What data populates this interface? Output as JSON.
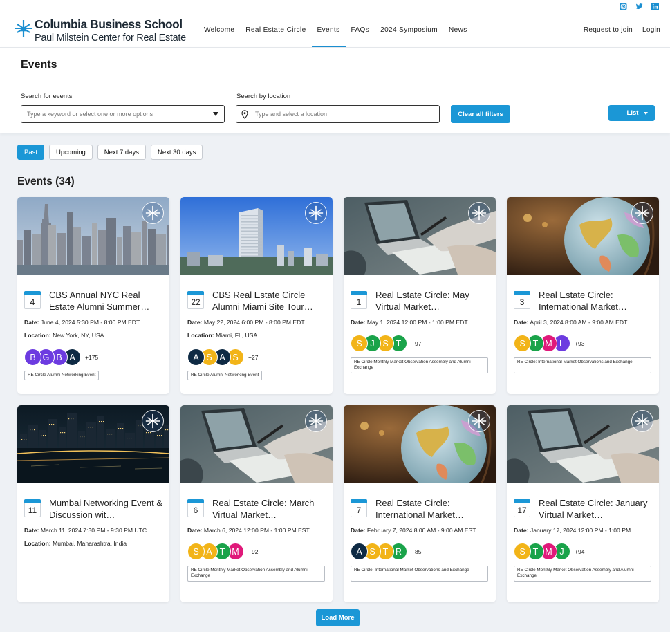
{
  "header": {
    "logo_title": "Columbia Business School",
    "logo_subtitle": "Paul Milstein Center for Real Estate",
    "nav": [
      "Welcome",
      "Real Estate Circle",
      "Events",
      "FAQs",
      "2024 Symposium",
      "News"
    ],
    "active_nav": "Events",
    "request_join": "Request to join",
    "login": "Login",
    "social": [
      "instagram-icon",
      "twitter-icon",
      "linkedin-icon"
    ]
  },
  "filters": {
    "title": "Events",
    "search_label": "Search for events",
    "search_placeholder": "Type a keyword or select one or more options",
    "location_label": "Search by location",
    "location_placeholder": "Type and select a location",
    "clear_button": "Clear all filters",
    "view_button": "List"
  },
  "tabs": [
    "Past",
    "Upcoming",
    "Next 7 days",
    "Next 30 days"
  ],
  "active_tab": "Past",
  "events_heading": "Events (34)",
  "load_more": "Load More",
  "date_label": "Date:",
  "location_label_short": "Location:",
  "colors": {
    "accent": "#1b97d6",
    "purple": "#6c3be0",
    "navy": "#0e2a44",
    "yellow": "#f2b418",
    "green": "#1aa34a",
    "magenta": "#e0197a"
  },
  "events": [
    {
      "day": "4",
      "title": "CBS Annual NYC Real Estate Alumni Summer…",
      "date": "June 4, 2024 5:30 PM - 8:00 PM EDT",
      "location": "New York, NY, USA",
      "image": "nyc-skyline",
      "avatars": [
        {
          "l": "B",
          "c": "#6c3be0"
        },
        {
          "l": "G",
          "c": "#6c3be0"
        },
        {
          "l": "B",
          "c": "#6c3be0"
        },
        {
          "l": "A",
          "c": "#0e2a44"
        }
      ],
      "more": "+175",
      "tag": "RE Circle Alumni Networking Event"
    },
    {
      "day": "22",
      "title": "CBS Real Estate Circle Alumni Miami Site Tour…",
      "date": "May 22, 2024 6:00 PM - 8:00 PM EDT",
      "location": "Miami, FL, USA",
      "image": "miami-tower",
      "avatars": [
        {
          "l": "A",
          "c": "#0e2a44"
        },
        {
          "l": "S",
          "c": "#f2b418"
        },
        {
          "l": "A",
          "c": "#0e2a44"
        },
        {
          "l": "S",
          "c": "#f2b418"
        }
      ],
      "more": "+27",
      "tag": "RE Circle Alumni Networking Event"
    },
    {
      "day": "1",
      "title": "Real Estate Circle: May Virtual Market…",
      "date": "May 1, 2024 12:00 PM - 1:00 PM EDT",
      "location": "",
      "image": "laptop-desk",
      "avatars": [
        {
          "l": "S",
          "c": "#f2b418"
        },
        {
          "l": "J",
          "c": "#1aa34a"
        },
        {
          "l": "S",
          "c": "#f2b418"
        },
        {
          "l": "T",
          "c": "#1aa34a"
        }
      ],
      "more": "+97",
      "tag": "RE Circle Monthly Market Observation Assembly and Alumni Exchange"
    },
    {
      "day": "3",
      "title": "Real Estate Circle: International Market…",
      "date": "April 3, 2024 8:00 AM - 9:00 AM EDT",
      "location": "",
      "image": "globe",
      "avatars": [
        {
          "l": "S",
          "c": "#f2b418"
        },
        {
          "l": "T",
          "c": "#1aa34a"
        },
        {
          "l": "M",
          "c": "#e0197a"
        },
        {
          "l": "L",
          "c": "#6c3be0"
        }
      ],
      "more": "+93",
      "tag": "RE Circle: International Market Observations and Exchange"
    },
    {
      "day": "11",
      "title": "Mumbai Networking Event & Discussion wit…",
      "date": "March 11, 2024 7:30 PM - 9:30 PM UTC",
      "location": "Mumbai, Maharashtra, India",
      "image": "mumbai-night",
      "avatars": [],
      "more": "",
      "tag": ""
    },
    {
      "day": "6",
      "title": "Real Estate Circle: March Virtual Market…",
      "date": "March 6, 2024 12:00 PM - 1:00 PM EST",
      "location": "",
      "image": "laptop-desk",
      "avatars": [
        {
          "l": "S",
          "c": "#f2b418"
        },
        {
          "l": "A",
          "c": "#f2b418"
        },
        {
          "l": "T",
          "c": "#1aa34a"
        },
        {
          "l": "M",
          "c": "#e0197a"
        }
      ],
      "more": "+92",
      "tag": "RE Circle Monthly Market Observation Assembly and Alumni Exchange"
    },
    {
      "day": "7",
      "title": "Real Estate Circle: International Market…",
      "date": "February 7, 2024 8:00 AM - 9:00 AM EST",
      "location": "",
      "image": "globe",
      "avatars": [
        {
          "l": "A",
          "c": "#0e2a44"
        },
        {
          "l": "S",
          "c": "#f2b418"
        },
        {
          "l": "T",
          "c": "#f2b418"
        },
        {
          "l": "R",
          "c": "#1aa34a"
        }
      ],
      "more": "+85",
      "tag": "RE Circle: International Market Observations and Exchange"
    },
    {
      "day": "17",
      "title": "Real Estate Circle: January Virtual Market…",
      "date": "January 17, 2024 12:00 PM - 1:00 PM…",
      "location": "",
      "image": "laptop-desk",
      "avatars": [
        {
          "l": "S",
          "c": "#f2b418"
        },
        {
          "l": "T",
          "c": "#1aa34a"
        },
        {
          "l": "M",
          "c": "#e0197a"
        },
        {
          "l": "J",
          "c": "#1aa34a"
        }
      ],
      "more": "+94",
      "tag": "RE Circle Monthly Market Observation Assembly and Alumni Exchange"
    }
  ]
}
